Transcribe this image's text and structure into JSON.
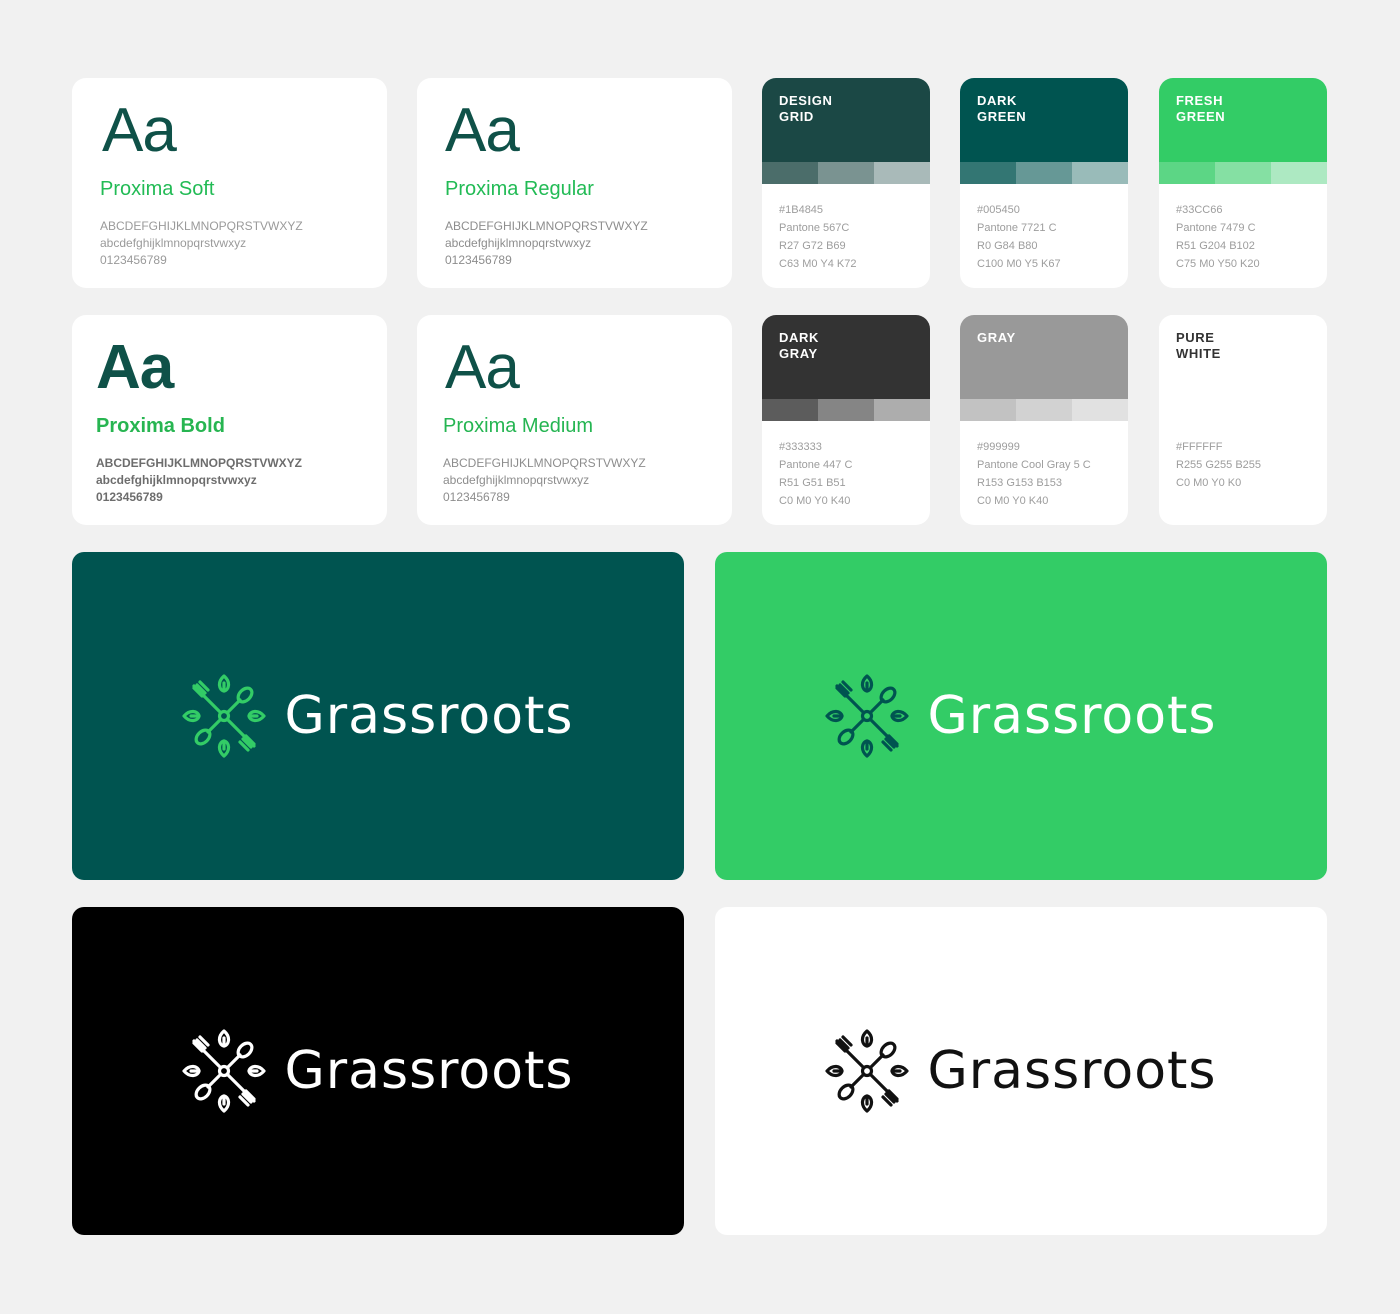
{
  "typography": [
    {
      "sample": "Aa",
      "name": "Proxima Soft",
      "upper": "ABCDEFGHIJKLMNOPQRSTVWXYZ",
      "lower": "abcdefghijklmnopqrstvwxyz",
      "digits": "0123456789"
    },
    {
      "sample": "Aa",
      "name": "Proxima Regular",
      "upper": "ABCDEFGHIJKLMNOPQRSTVWXYZ",
      "lower": "abcdefghijklmnopqrstvwxyz",
      "digits": "0123456789"
    },
    {
      "sample": "Aa",
      "name": "Proxima Bold",
      "upper": "ABCDEFGHIJKLMNOPQRSTVWXYZ",
      "lower": "abcdefghijklmnopqrstvwxyz",
      "digits": "0123456789"
    },
    {
      "sample": "Aa",
      "name": "Proxima Medium",
      "upper": "ABCDEFGHIJKLMNOPQRSTVWXYZ",
      "lower": "abcdefghijklmnopqrstvwxyz",
      "digits": "0123456789"
    }
  ],
  "colors": [
    {
      "title": "DESIGN\nGRID",
      "color": "#1B4845",
      "tints": [
        "#4b6d6a",
        "#7a9391",
        "#a9bab9"
      ],
      "title_color": "#ffffff",
      "codes": [
        "#1B4845",
        "Pantone 567C",
        "R27 G72 B69",
        "C63 M0 Y4 K72"
      ]
    },
    {
      "title": "DARK\nGREEN",
      "color": "#005450",
      "tints": [
        "#337673",
        "#669896",
        "#99bbb9"
      ],
      "title_color": "#ffffff",
      "codes": [
        "#005450",
        "Pantone 7721 C",
        "R0 G84 B80",
        "C100 M0 Y5 K67"
      ]
    },
    {
      "title": "FRESH\nGREEN",
      "color": "#33CC66",
      "tints": [
        "#5cd685",
        "#85e0a3",
        "#ade9c2"
      ],
      "title_color": "#ffffff",
      "codes": [
        "#33CC66",
        "Pantone 7479 C",
        "R51 G204 B102",
        "C75 M0 Y50 K20"
      ]
    },
    {
      "title": "DARK\nGRAY",
      "color": "#333333",
      "tints": [
        "#5c5c5c",
        "#858585",
        "#adadad"
      ],
      "title_color": "#ffffff",
      "codes": [
        "#333333",
        "Pantone 447 C",
        "R51 G51 B51",
        "C0 M0 Y0 K40"
      ]
    },
    {
      "title": "GRAY",
      "color": "#999999",
      "tints": [
        "#c2c2c2",
        "#d2d2d2",
        "#e1e1e1"
      ],
      "title_color": "#ffffff",
      "codes": [
        "#999999",
        "Pantone Cool Gray 5 C",
        "R153 G153 B153",
        "C0 M0 Y0 K40"
      ]
    },
    {
      "title": "PURE\nWHITE",
      "color": "#FFFFFF",
      "tints": [
        "#ffffff",
        "#ffffff",
        "#ffffff"
      ],
      "title_color": "#333333",
      "codes": [
        "#FFFFFF",
        "R255 G255 B255",
        "C0 M0 Y0 K0"
      ]
    }
  ],
  "logos": [
    {
      "brand": "Grassroots",
      "background": "#005450",
      "text_color": "#ffffff",
      "mark_color": "#33cc66",
      "mark_icon": "grassroots-mark-icon"
    },
    {
      "brand": "Grassroots",
      "background": "#33cc66",
      "text_color": "#ffffff",
      "mark_color": "#005450",
      "mark_icon": "grassroots-mark-icon"
    },
    {
      "brand": "Grassroots",
      "background": "#000000",
      "text_color": "#ffffff",
      "mark_color": "#ffffff",
      "mark_icon": "grassroots-mark-icon"
    },
    {
      "brand": "Grassroots",
      "background": "#ffffff",
      "text_color": "#111111",
      "mark_color": "#111111",
      "mark_icon": "grassroots-mark-icon"
    }
  ]
}
